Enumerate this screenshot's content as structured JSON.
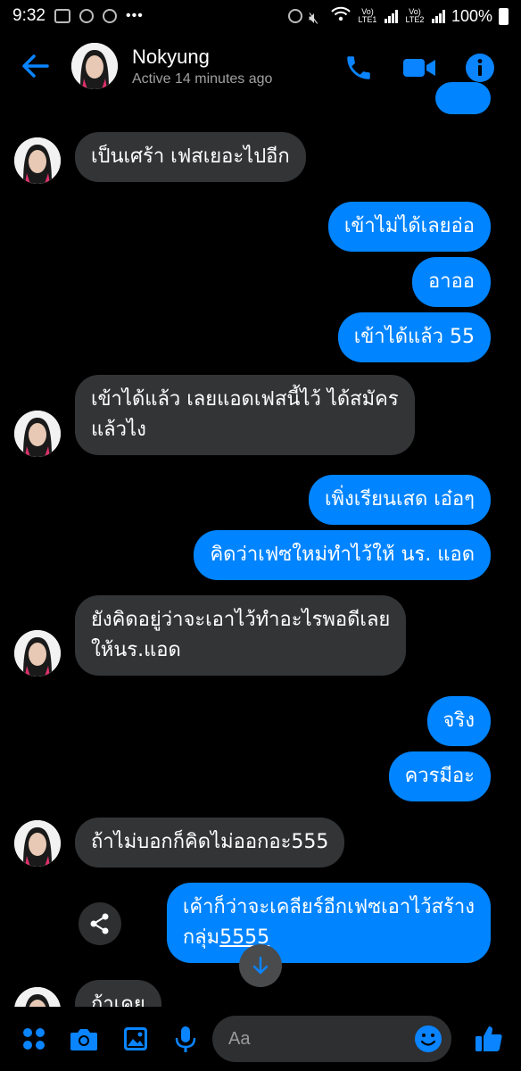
{
  "status_bar": {
    "time": "9:32",
    "network_1": "Vo) LTE1",
    "network_2": "Vo) LTE2",
    "battery": "100%"
  },
  "header": {
    "contact_name": "Nokyung",
    "status": "Active 14 minutes ago",
    "icons": [
      "back-arrow-icon",
      "phone-icon",
      "video-call-icon",
      "info-icon"
    ]
  },
  "messages": [
    {
      "from": "them",
      "text": "เป็นเศร้า เฟสเยอะไปอีก"
    },
    {
      "from": "me",
      "text": "เข้าไม่ได้เลยอ่อ"
    },
    {
      "from": "me",
      "text": "อาออ"
    },
    {
      "from": "me",
      "text": "เข้าได้แล้ว 55"
    },
    {
      "from": "them",
      "text_line1": "เข้าได้แล้ว เลยแอดเฟสนี้ไว้ ได้สมัคร",
      "text_line2": "แล้วไง"
    },
    {
      "from": "me",
      "text": "เพิ่งเรียนเสด เอ๋อๆ"
    },
    {
      "from": "me",
      "text": "คิดว่าเฟซใหม่ทำไว้ให้ นร. แอด"
    },
    {
      "from": "them",
      "text_line1": "ยังคิดอยู่ว่าจะเอาไว้ทำอะไรพอดีเลย",
      "text_line2": "ให้นร.แอด"
    },
    {
      "from": "me",
      "text": "จริง"
    },
    {
      "from": "me",
      "text": "ควรมีอะ"
    },
    {
      "from": "them",
      "text": "ถ้าไม่บอกก็คิดไม่ออกอะ555"
    },
    {
      "from": "me",
      "text_line1": "เค้าก็ว่าจะเคลียร์อีกเฟซเอาไว้สร้าง",
      "text_line2a": "กลุ่ม",
      "text_line2b": "5555"
    },
    {
      "from": "them",
      "text": "ก้าเคย"
    }
  ],
  "composer": {
    "placeholder": "Aa"
  },
  "colors": {
    "accent": "#0084ff",
    "incoming_bubble": "#333436",
    "background": "#000000"
  }
}
